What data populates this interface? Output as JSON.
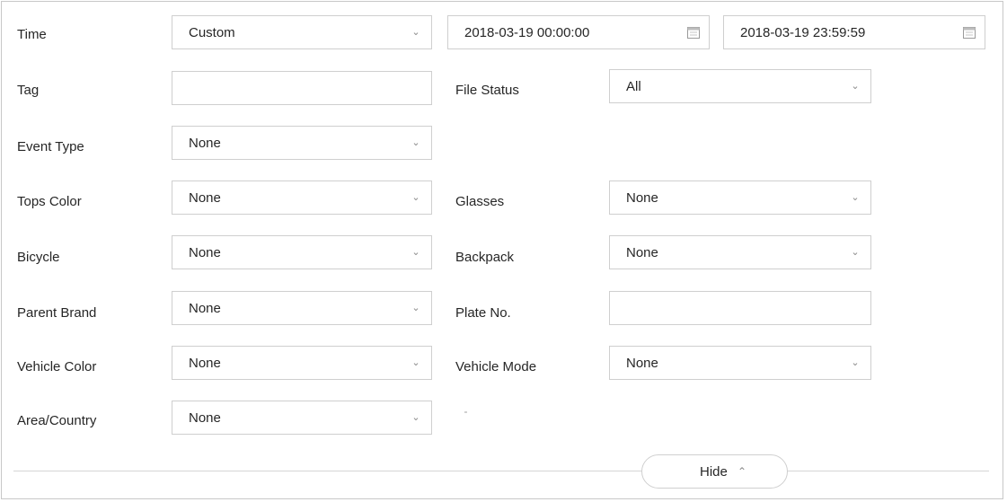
{
  "filters": {
    "time": {
      "label": "Time",
      "mode": "Custom",
      "start": "2018-03-19 00:00:00",
      "end": "2018-03-19 23:59:59"
    },
    "tag": {
      "label": "Tag",
      "value": ""
    },
    "file_status": {
      "label": "File Status",
      "value": "All"
    },
    "event_type": {
      "label": "Event Type",
      "value": "None"
    },
    "tops_color": {
      "label": "Tops Color",
      "value": "None"
    },
    "glasses": {
      "label": "Glasses",
      "value": "None"
    },
    "bicycle": {
      "label": "Bicycle",
      "value": "None"
    },
    "backpack": {
      "label": "Backpack",
      "value": "None"
    },
    "parent_brand": {
      "label": "Parent Brand",
      "value": "None"
    },
    "plate_no": {
      "label": "Plate No.",
      "value": ""
    },
    "vehicle_color": {
      "label": "Vehicle Color",
      "value": "None"
    },
    "vehicle_mode": {
      "label": "Vehicle Mode",
      "value": "None"
    },
    "area_country": {
      "label": "Area/Country",
      "value": "None"
    }
  },
  "footer": {
    "hide_label": "Hide",
    "hide_icon": "double-chevron-up-icon"
  },
  "icons": {
    "dropdown": "chevron-down-icon",
    "calendar": "calendar-icon"
  },
  "colors": {
    "border": "#cfcfcf",
    "text": "#262626",
    "caret": "#8a8a8a"
  }
}
